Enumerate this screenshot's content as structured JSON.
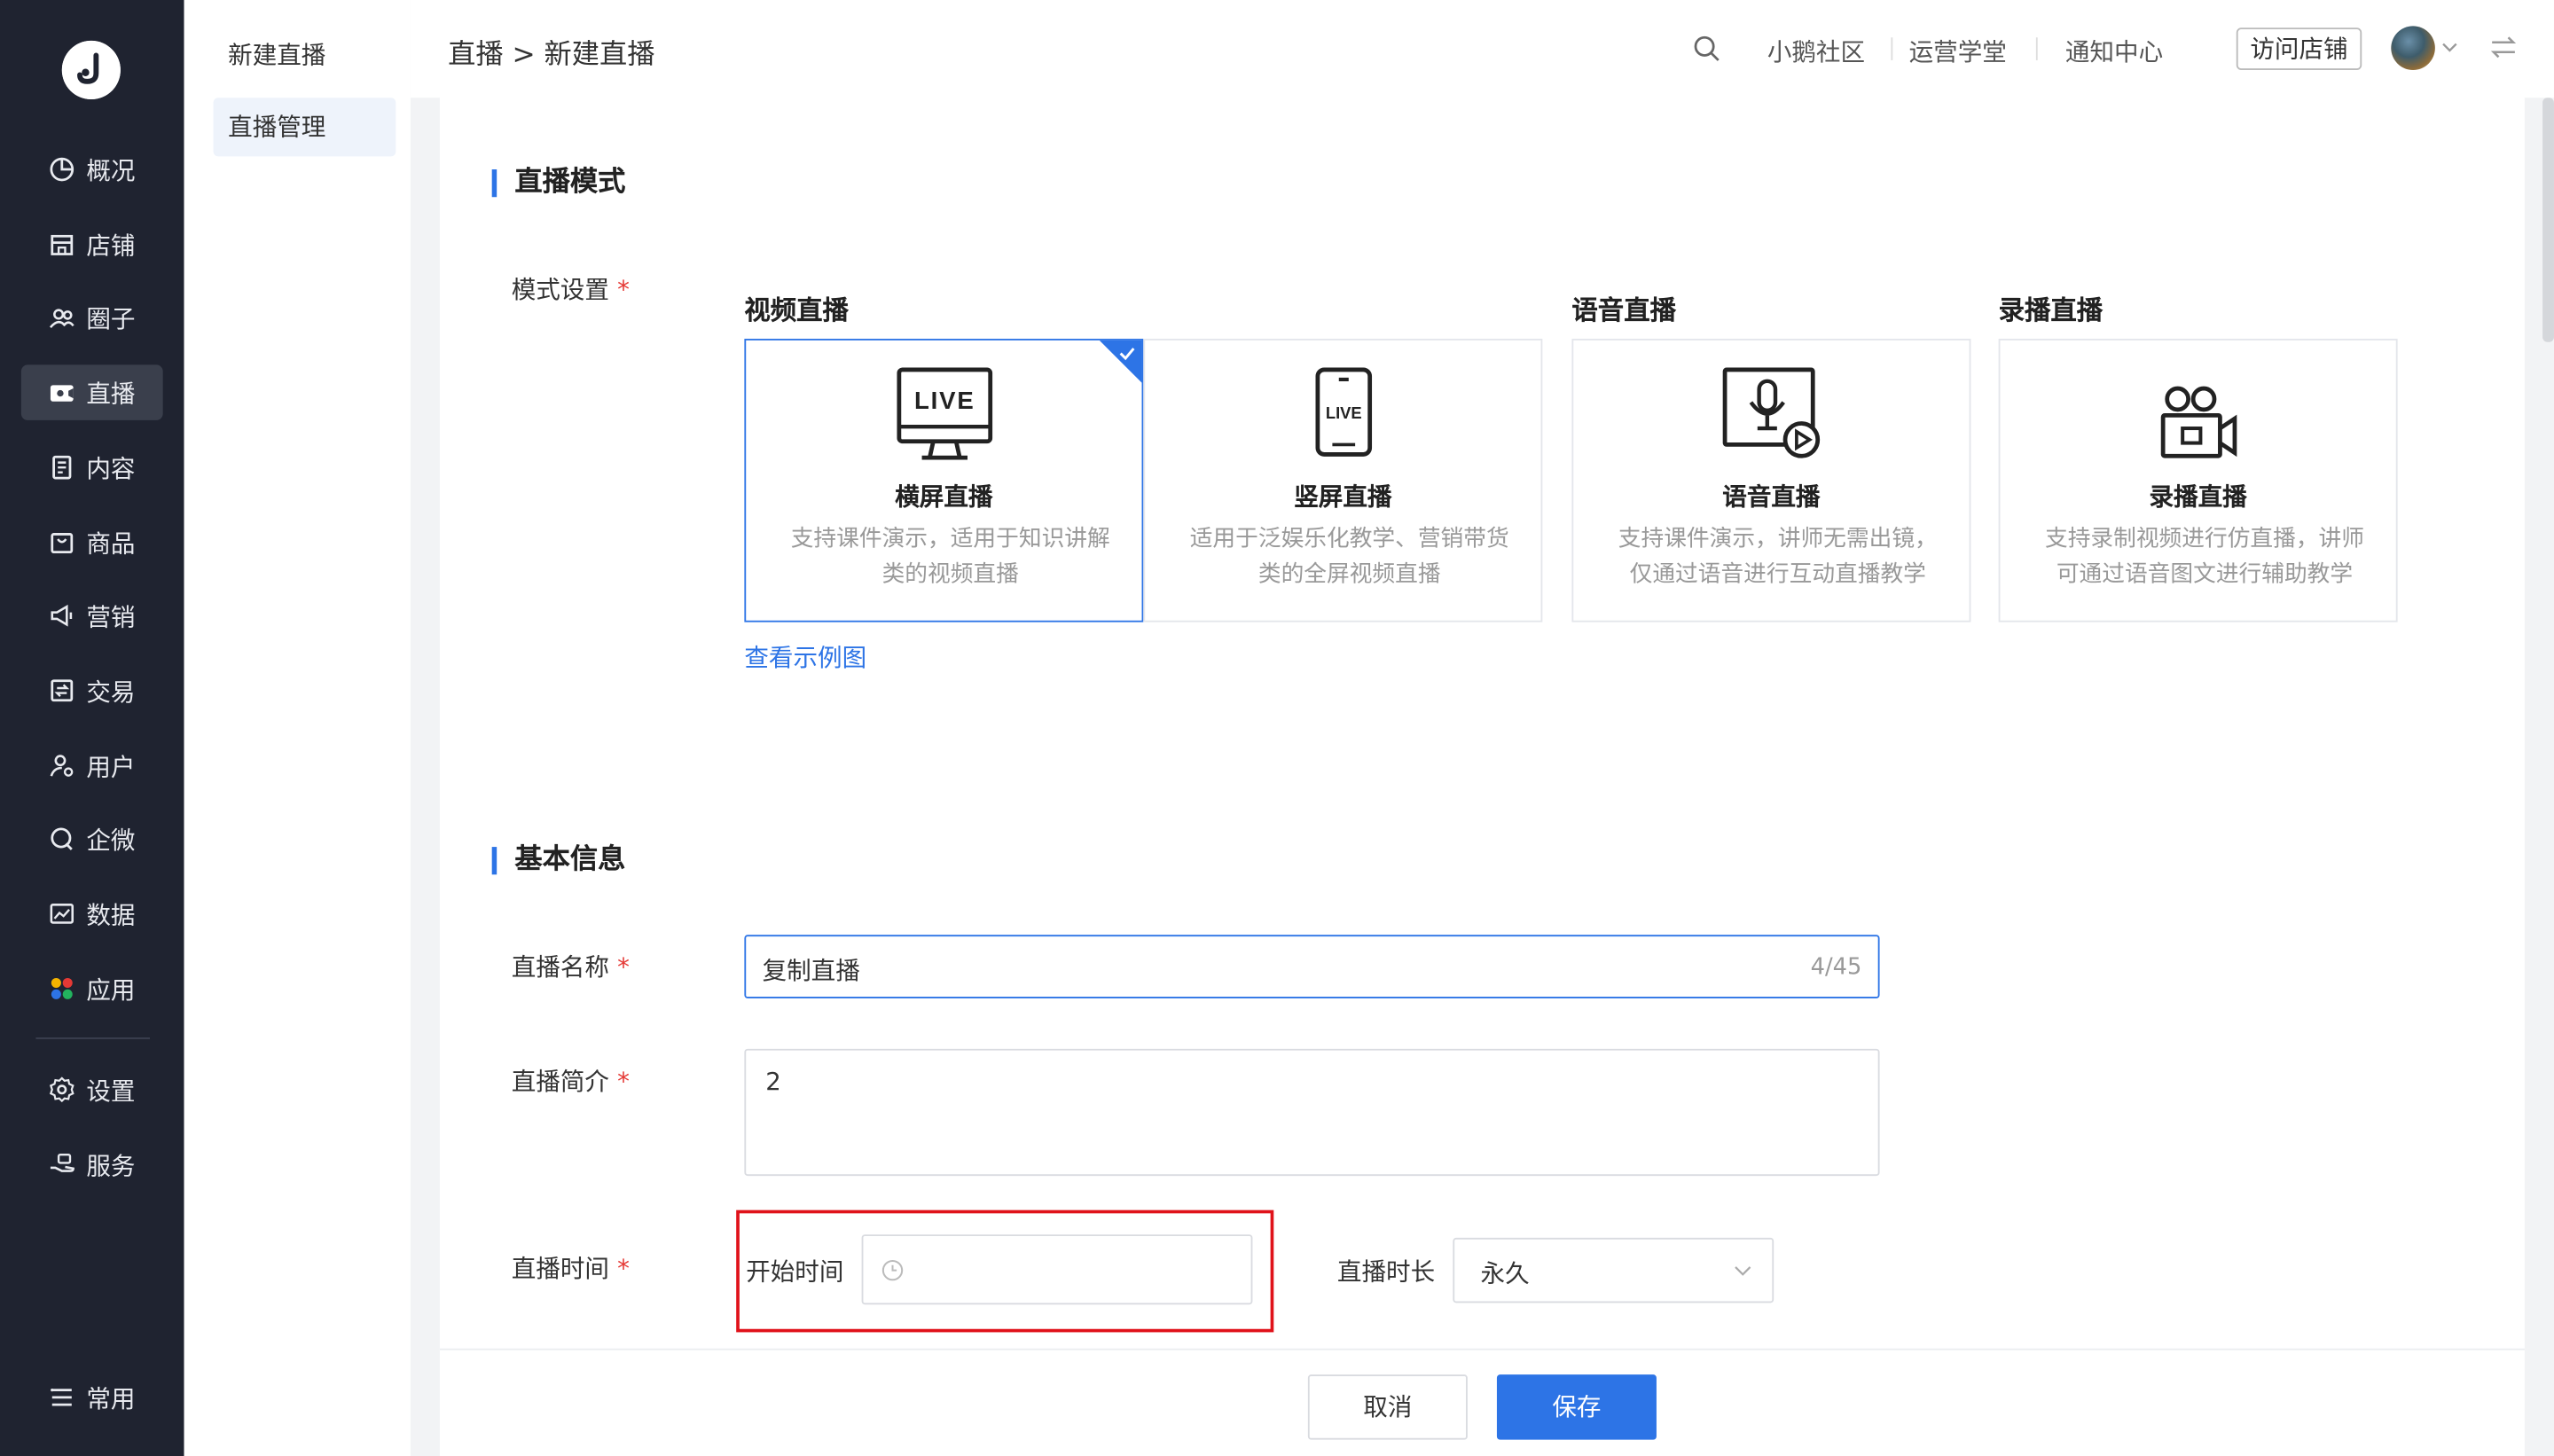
{
  "sidebar": {
    "items": [
      {
        "label": "概况",
        "icon": "pie-chart-icon"
      },
      {
        "label": "店铺",
        "icon": "store-icon"
      },
      {
        "label": "圈子",
        "icon": "group-icon"
      },
      {
        "label": "直播",
        "icon": "video-camera-icon",
        "active": true
      },
      {
        "label": "内容",
        "icon": "document-icon"
      },
      {
        "label": "商品",
        "icon": "bag-icon"
      },
      {
        "label": "营销",
        "icon": "megaphone-icon"
      },
      {
        "label": "交易",
        "icon": "transaction-icon"
      },
      {
        "label": "用户",
        "icon": "user-gear-icon"
      },
      {
        "label": "企微",
        "icon": "wecom-icon"
      },
      {
        "label": "数据",
        "icon": "data-chart-icon"
      },
      {
        "label": "应用",
        "icon": "apps-grid-icon"
      },
      {
        "label": "设置",
        "icon": "gear-icon"
      },
      {
        "label": "服务",
        "icon": "service-hand-icon"
      }
    ],
    "bottom": {
      "label": "常用",
      "icon": "list-icon"
    }
  },
  "subnav": {
    "items": [
      {
        "label": "新建直播"
      },
      {
        "label": "直播管理",
        "active": true
      }
    ]
  },
  "topbar": {
    "breadcrumb": "直播 > 新建直播",
    "links": [
      "小鹅社区",
      "运营学堂",
      "通知中心"
    ],
    "visit_store": "访问店铺"
  },
  "mode_section": {
    "title": "直播模式",
    "label": "模式设置",
    "groups": [
      "视频直播",
      "语音直播",
      "录播直播"
    ],
    "cards": [
      {
        "name": "横屏直播",
        "desc": "支持课件演示，适用于知识讲解类的视频直播",
        "icon": "monitor-live-icon",
        "selected": true
      },
      {
        "name": "竖屏直播",
        "desc": "适用于泛娱乐化教学、营销带货类的全屏视频直播",
        "icon": "phone-live-icon",
        "selected": false
      },
      {
        "name": "语音直播",
        "desc": "支持课件演示，讲师无需出镜，仅通过语音进行互动直播教学",
        "icon": "microphone-screen-icon",
        "selected": false
      },
      {
        "name": "录播直播",
        "desc": "支持录制视频进行仿直播，讲师可通过语音图文进行辅助教学",
        "icon": "video-recorder-icon",
        "selected": false
      }
    ],
    "example_link": "查看示例图"
  },
  "basic_section": {
    "title": "基本信息",
    "name_label": "直播名称",
    "name_value": "复制直播",
    "name_count": "4/45",
    "desc_label": "直播简介",
    "desc_value": "2",
    "time_label": "直播时间",
    "start_label": "开始时间",
    "start_placeholder": "",
    "duration_label": "直播时长",
    "duration_value": "永久"
  },
  "footer": {
    "cancel": "取消",
    "save": "保存"
  },
  "colors": {
    "sidebar_bg": "#1f2330",
    "accent": "#2d74e6",
    "required": "#e53935",
    "highlight": "#e0121a"
  }
}
